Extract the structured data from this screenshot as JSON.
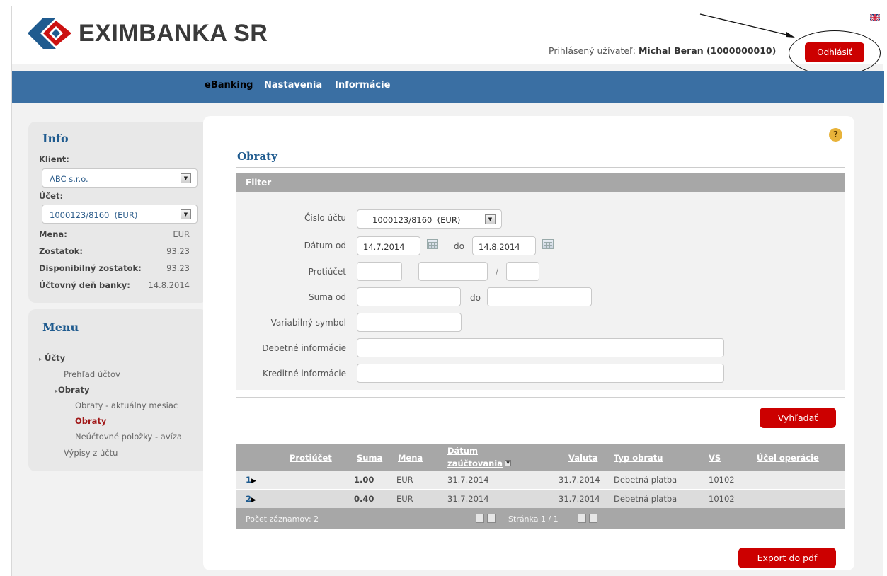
{
  "app": {
    "brand": "EXIMBANKA SR"
  },
  "header": {
    "user_label": "Prihlásený užívateľ:",
    "user_name": "Michal Beran (1000000010)",
    "logout_label": "Odhlásiť"
  },
  "nav": [
    {
      "label": "eBanking"
    },
    {
      "label": "Nastavenia"
    },
    {
      "label": "Informácie"
    }
  ],
  "info": {
    "title": "Info",
    "client_label": "Klient:",
    "client_value": "ABC s.r.o.",
    "account_label": "Účet:",
    "account_value": "1000123/8160  (EUR)",
    "rows": [
      {
        "label": "Mena:",
        "value": "EUR"
      },
      {
        "label": "Zostatok:",
        "value": "93.23"
      },
      {
        "label": "Disponibilný zostatok:",
        "value": "93.23"
      },
      {
        "label": "Účtovný deň banky:",
        "value": "14.8.2014"
      }
    ]
  },
  "menu": {
    "title": "Menu",
    "items": [
      {
        "label": "Účty"
      },
      {
        "label": "Prehľad účtov"
      },
      {
        "label": "Obraty"
      },
      {
        "label": "Obraty - aktuálny mesiac"
      },
      {
        "label": "Obraty"
      },
      {
        "label": "Neúčtovné položky - avíza"
      },
      {
        "label": "Výpisy z účtu"
      }
    ]
  },
  "main": {
    "title": "Obraty",
    "help": "?",
    "filter": {
      "title": "Filter",
      "account_label": "Číslo účtu",
      "account_value": "1000123/8160  (EUR)",
      "date_from_label": "Dátum od",
      "date_from_value": "14.7.2014",
      "date_to_label": "do",
      "date_to_value": "14.8.2014",
      "counter_label": "Protiúčet",
      "counter_sep1": "-",
      "counter_sep2": "/",
      "amount_label": "Suma od",
      "amount_to_label": "do",
      "vs_label": "Variabilný symbol",
      "debit_label": "Debetné informácie",
      "credit_label": "Kreditné informácie",
      "search_label": "Vyhľadať"
    },
    "table": {
      "columns": [
        "Protiúčet",
        "Suma",
        "Mena",
        "Dátum",
        "zaúčtovania",
        "Valuta",
        "Typ obratu",
        "VS",
        "Účel operácie"
      ],
      "rows": [
        {
          "num": "1",
          "amount": "1.00",
          "currency": "EUR",
          "date": "31.7.2014",
          "valuta": "31.7.2014",
          "type": "Debetná platba",
          "vs": "10102"
        },
        {
          "num": "2",
          "amount": "0.40",
          "currency": "EUR",
          "date": "31.7.2014",
          "valuta": "31.7.2014",
          "type": "Debetná platba",
          "vs": "10102"
        }
      ],
      "count_label": "Počet záznamov: 2",
      "page_label": "Stránka 1 / 1"
    },
    "export_label": "Export do pdf"
  },
  "colors": {
    "nav_blue": "#3a6fa3",
    "accent_red": "#cc0000",
    "title_blue": "#1f5b8f",
    "header_gray": "#a7a7a7"
  }
}
